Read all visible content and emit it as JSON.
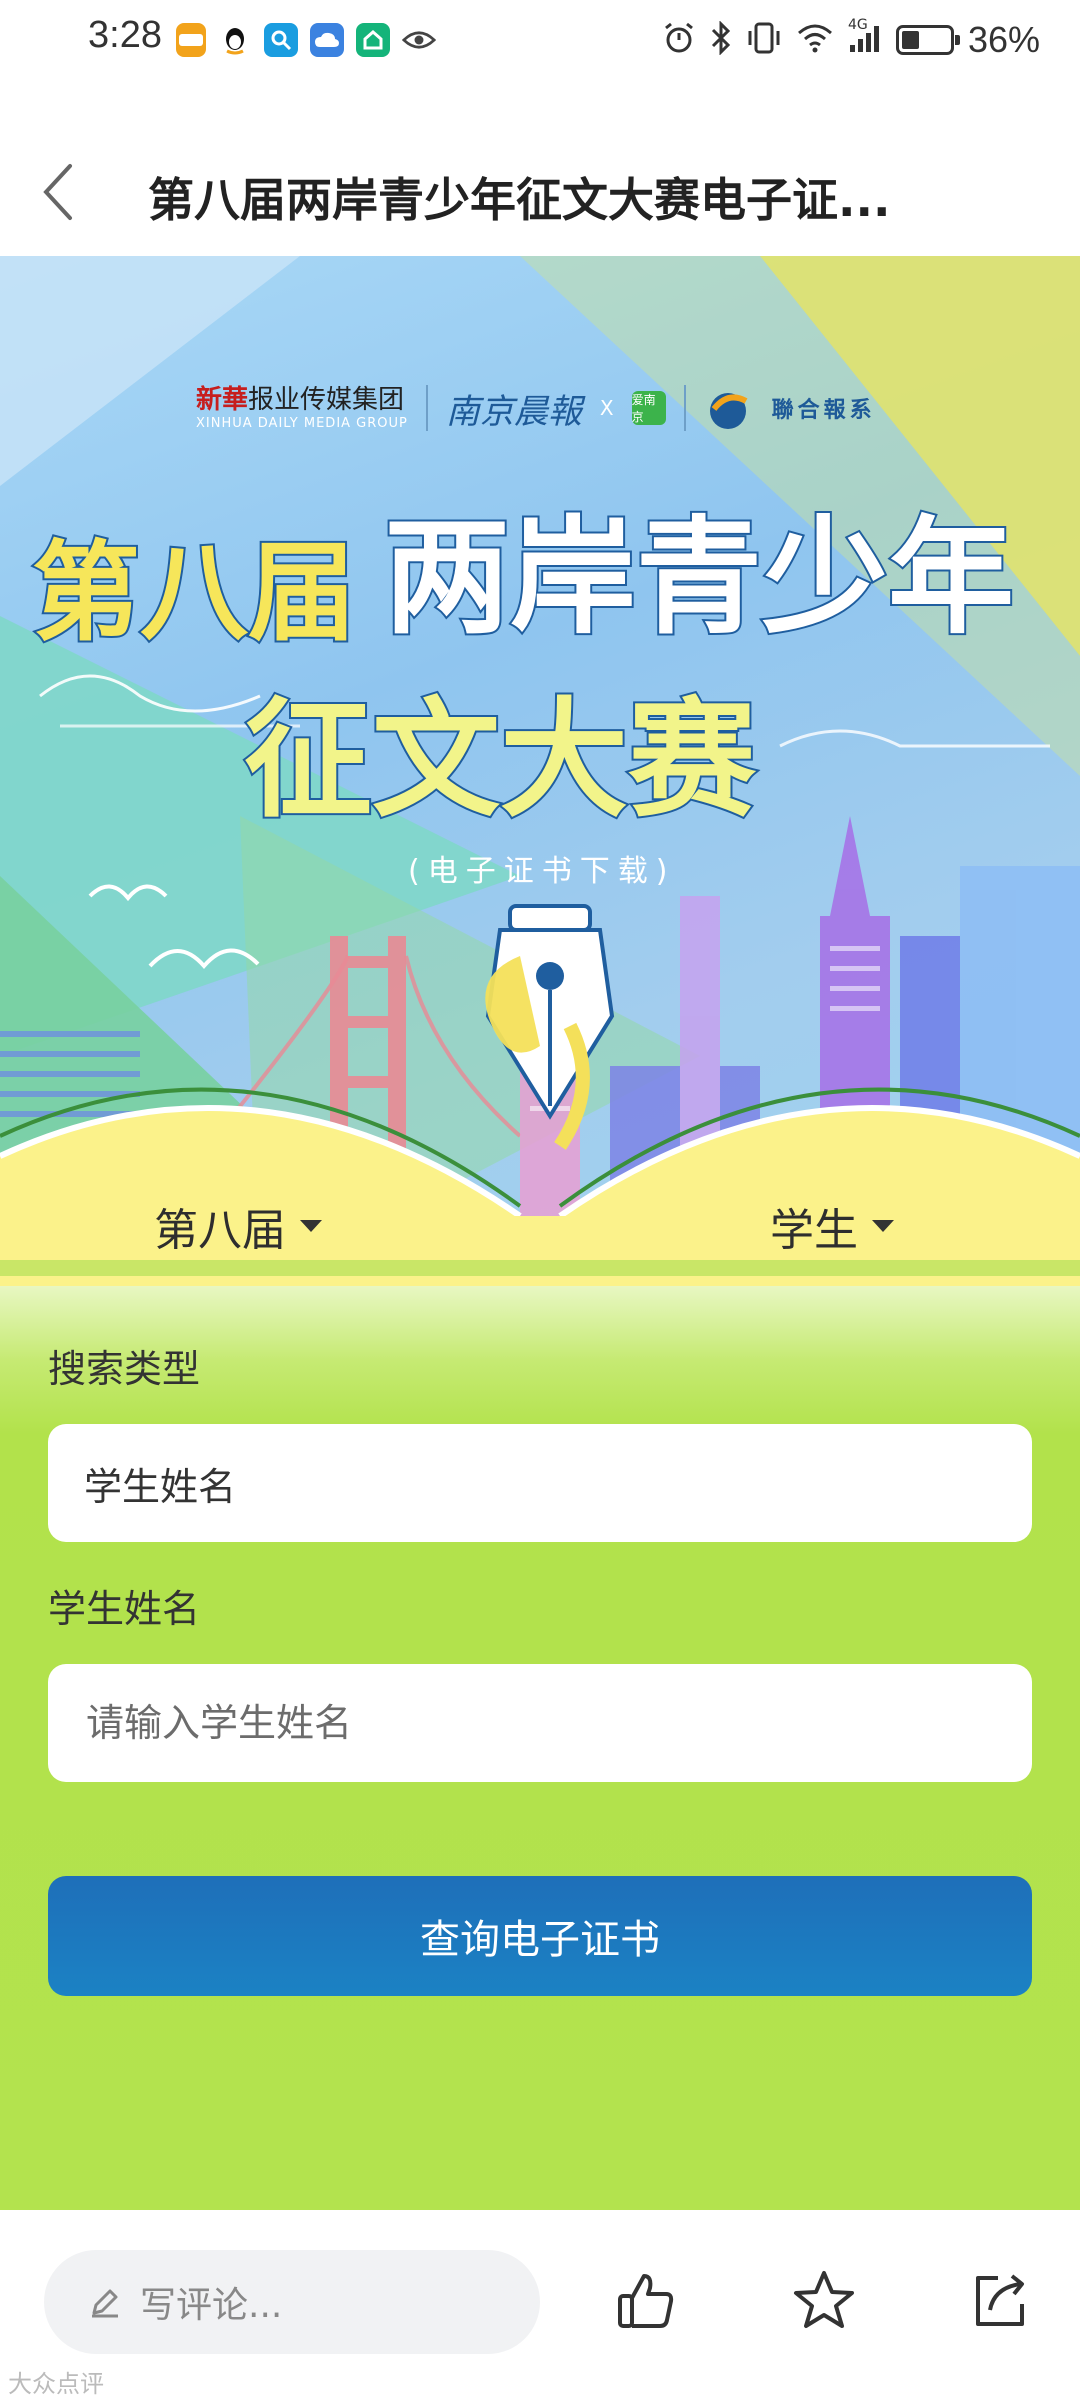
{
  "status_bar": {
    "time": "3:28",
    "left_apps": [
      "taobao-icon",
      "qq-icon",
      "search-app-icon",
      "cloud-app-icon",
      "home-app-icon",
      "eye-icon"
    ],
    "right_icons": [
      "alarm-icon",
      "bluetooth-icon",
      "vibrate-icon",
      "wifi-icon",
      "signal-icon"
    ],
    "network": "4G",
    "battery_percent": "36%",
    "battery_level": 0.36
  },
  "header": {
    "title": "第八届两岸青少年征文大赛电子证..."
  },
  "banner": {
    "sponsor_xinhua_brand": "新華",
    "sponsor_xinhua": "报业传媒集团",
    "sponsor_xinhua_en": "XINHUA DAILY MEDIA GROUP",
    "sponsor_nanjing": "南京晨報",
    "sponsor_x": "X",
    "sponsor_app": "爱南京",
    "sponsor_union": "聯合報系",
    "title_line1_a": "第八届",
    "title_line1_b": "两岸青少年",
    "title_line2": "征文大赛",
    "subtitle": "(电子证书下载)",
    "session_select": "第八届",
    "role_select": "学生"
  },
  "form": {
    "search_type_label": "搜索类型",
    "search_type_value": "学生姓名",
    "name_label": "学生姓名",
    "name_placeholder": "请输入学生姓名",
    "query_button": "查询电子证书"
  },
  "bottom_bar": {
    "comment_placeholder": "写评论...",
    "watermark": "大众点评"
  },
  "colors": {
    "form_green": "#b3e34e",
    "button_blue": "#1e73bb",
    "title_stroke": "#1f5e9f",
    "title_yellow": "#f6e65a"
  }
}
